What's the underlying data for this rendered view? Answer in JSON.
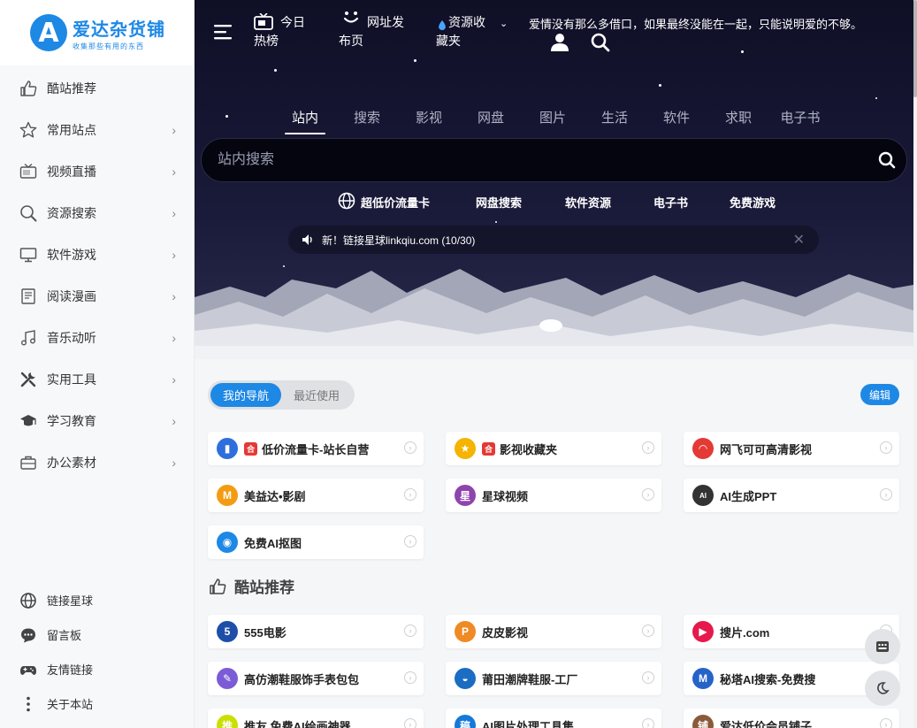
{
  "site": {
    "name": "爱达杂货铺",
    "tagline": "收集那些有用的东西",
    "logo_letter": "A",
    "accent": "#1e88e5"
  },
  "sidebar": {
    "items": [
      {
        "label": "酷站推荐",
        "icon": "thumbs-up-icon",
        "chevron": false
      },
      {
        "label": "常用站点",
        "icon": "star-icon",
        "chevron": true
      },
      {
        "label": "视频直播",
        "icon": "tv-icon",
        "chevron": true
      },
      {
        "label": "资源搜索",
        "icon": "search-icon",
        "chevron": true
      },
      {
        "label": "软件游戏",
        "icon": "monitor-icon",
        "chevron": true
      },
      {
        "label": "阅读漫画",
        "icon": "book-icon",
        "chevron": true
      },
      {
        "label": "音乐动听",
        "icon": "music-icon",
        "chevron": true
      },
      {
        "label": "实用工具",
        "icon": "tools-icon",
        "chevron": true
      },
      {
        "label": "学习教育",
        "icon": "graduation-cap-icon",
        "chevron": true
      },
      {
        "label": "办公素材",
        "icon": "briefcase-icon",
        "chevron": true
      }
    ],
    "bottom": [
      {
        "label": "链接星球",
        "icon": "globe-icon"
      },
      {
        "label": "留言板",
        "icon": "chat-icon"
      },
      {
        "label": "友情链接",
        "icon": "gamepad-icon"
      },
      {
        "label": "关于本站",
        "icon": "more-vertical-icon"
      }
    ],
    "chevron_glyph": "›"
  },
  "topbar": {
    "hot": "今日\n热榜",
    "nav": "网址发\n布页",
    "resource": "资源收\n藏夹",
    "quote": "爱情没有那么多借口，如果最终没能在一起，只能说明爱的不够。"
  },
  "search": {
    "tabs": [
      "站内",
      "搜索",
      "影视",
      "网盘",
      "图片",
      "生活",
      "软件",
      "求职",
      "电子书"
    ],
    "active_tab": 0,
    "placeholder": "站内搜索",
    "quick_links": [
      "超低价流量卡",
      "网盘搜索",
      "软件资源",
      "电子书",
      "免费游戏"
    ],
    "notice": "新！链接星球linkqiu.com (10/30)",
    "notice_close": "✕"
  },
  "main": {
    "toggle_on": "我的导航",
    "toggle_off": "最近使用",
    "edit": "编辑",
    "my_nav": [
      {
        "label": "低价流量卡-站长自营",
        "hot": true,
        "icon_color": "#2f6fdc",
        "icon_glyph": "▮"
      },
      {
        "label": "影视收藏夹",
        "hot": true,
        "icon_color": "#f4b400",
        "icon_glyph": "★"
      },
      {
        "label": "网飞可可高清影视",
        "hot": false,
        "icon_color": "#e53935",
        "icon_glyph": "◠"
      },
      {
        "label": "美益达•影剧",
        "hot": false,
        "icon_color": "#f39c12",
        "icon_glyph": "M"
      },
      {
        "label": "星球视频",
        "hot": false,
        "icon_color": "#8e44ad",
        "icon_glyph": "星"
      },
      {
        "label": "AI生成PPT",
        "hot": false,
        "icon_color": "#333333",
        "icon_glyph": "AI"
      },
      {
        "label": "免费AI抠图",
        "hot": false,
        "icon_color": "#1e88e5",
        "icon_glyph": "◉"
      }
    ],
    "hot_badge": "合",
    "section_title": "酷站推荐",
    "recommend": [
      {
        "label": "555电影",
        "icon_color": "#1e4fa8",
        "icon_glyph": "5"
      },
      {
        "label": "皮皮影视",
        "icon_color": "#f08a24",
        "icon_glyph": "P"
      },
      {
        "label": "搜片.com",
        "icon_color": "#e5194b",
        "icon_glyph": "▶"
      },
      {
        "label": "高仿潮鞋服饰手表包包",
        "icon_color": "#7b5cd6",
        "icon_glyph": "✎"
      },
      {
        "label": "莆田潮牌鞋服-工厂",
        "icon_color": "#1a6dc2",
        "icon_glyph": "◒"
      },
      {
        "label": "秘塔AI搜索-免费搜",
        "icon_color": "#2563c9",
        "icon_glyph": "M"
      },
      {
        "label": "推友 免费AI绘画神器",
        "icon_color": "#c9e000",
        "icon_glyph": "推"
      },
      {
        "label": "AI图片处理工具集",
        "icon_color": "#1479d8",
        "icon_glyph": "稿"
      },
      {
        "label": "爱达低价会员铺子",
        "icon_color": "#8a5a3a",
        "icon_glyph": "铺"
      }
    ],
    "go_glyph": "›"
  }
}
